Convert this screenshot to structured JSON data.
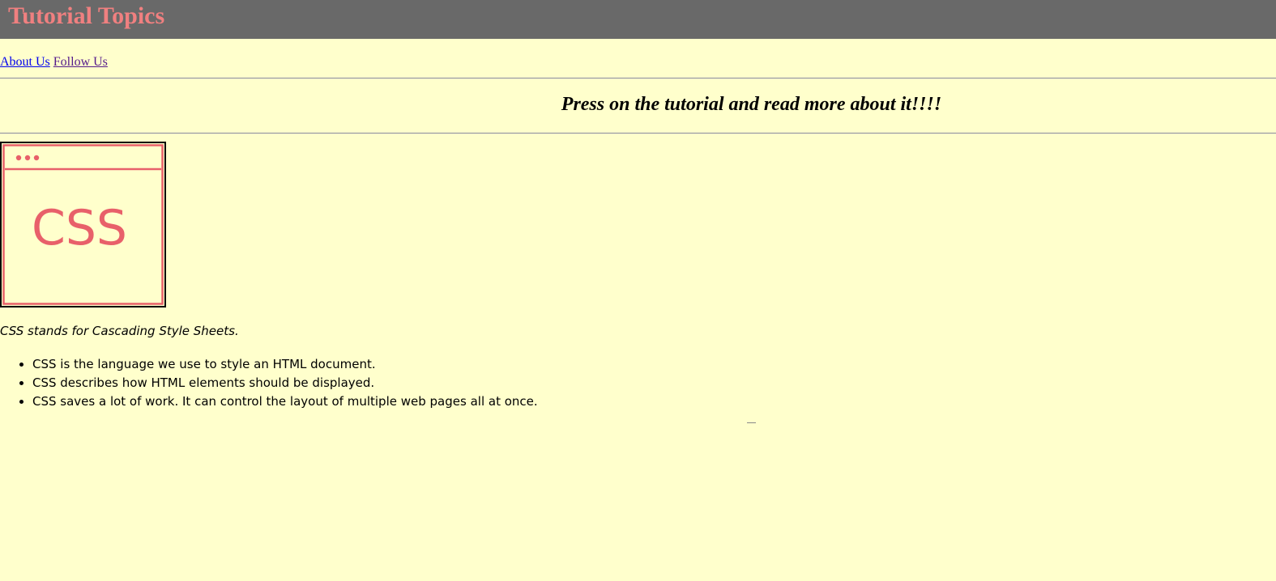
{
  "header": {
    "title": "Tutorial Topics",
    "background": "#696969",
    "title_color": "#f08080"
  },
  "nav": {
    "about_label": "About Us",
    "follow_label": "Follow Us"
  },
  "tagline": "Press on the tutorial and read more about it!!!!",
  "tutorial_tile": {
    "label": "CSS",
    "accent_color": "#e8606a",
    "icon": "browser-window-icon"
  },
  "description": "CSS stands for Cascading Style Sheets.",
  "facts": [
    "CSS is the language we use to style an HTML document.",
    "CSS describes how HTML elements should be displayed.",
    "CSS saves a lot of work. It can control the layout of multiple web pages all at once."
  ],
  "page_background": "#ffffcc"
}
